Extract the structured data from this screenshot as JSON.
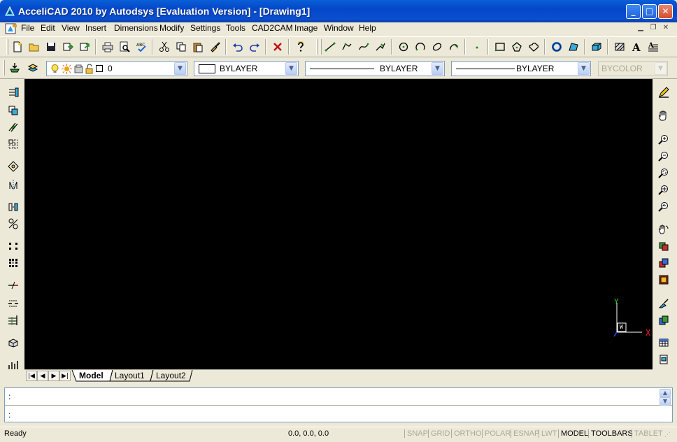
{
  "window": {
    "title": "AcceliCAD 2010 by Autodsys [Evaluation Version]  - [Drawing1]",
    "minimize_glyph": "_",
    "maximize_glyph": "□",
    "close_glyph": "✕"
  },
  "menu": [
    {
      "label": "File",
      "key": "file"
    },
    {
      "label": "Edit",
      "key": "edit"
    },
    {
      "label": "View",
      "key": "view"
    },
    {
      "label": "Insert",
      "key": "insert"
    },
    {
      "label": "Dimensions",
      "key": "dimensions"
    },
    {
      "label": "Modify",
      "key": "modify"
    },
    {
      "label": "Settings",
      "key": "settings"
    },
    {
      "label": "Tools",
      "key": "tools"
    },
    {
      "label": "CAD2CAM",
      "key": "cad2cam"
    },
    {
      "label": "Image",
      "key": "image"
    },
    {
      "label": "Window",
      "key": "window"
    },
    {
      "label": "Help",
      "key": "help"
    }
  ],
  "properties": {
    "layer": "0",
    "color": "BYLAYER",
    "linetype": "BYLAYER",
    "lineweight": "BYLAYER",
    "plotstyle": "BYCOLOR"
  },
  "layout_tabs": {
    "model": "Model",
    "layout1": "Layout1",
    "layout2": "Layout2"
  },
  "ucs": {
    "x": "X",
    "y": "Y",
    "w": "W"
  },
  "command": {
    "history_prompt": ":",
    "input_prompt": ":"
  },
  "status": {
    "ready": "Ready",
    "coords": "0.0, 0.0, 0.0",
    "buttons": [
      {
        "label": "SNAP",
        "state": "off"
      },
      {
        "label": "GRID",
        "state": "off"
      },
      {
        "label": "ORTHO",
        "state": "off"
      },
      {
        "label": "POLAR",
        "state": "off"
      },
      {
        "label": "ESNAP",
        "state": "off"
      },
      {
        "label": "LWT",
        "state": "off"
      },
      {
        "label": "MODEL",
        "state": "on"
      },
      {
        "label": "TOOLBARS",
        "state": "on"
      },
      {
        "label": "TABLET",
        "state": "off"
      }
    ]
  },
  "colors": {
    "canvas": "#000000",
    "titlebar": "#0447c8",
    "chrome": "#ece9d8"
  }
}
